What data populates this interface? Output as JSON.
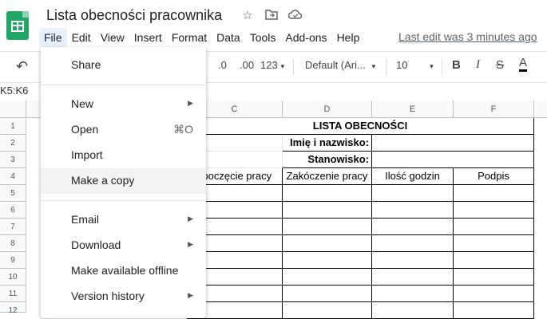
{
  "doc": {
    "title": "Lista obecności pracownika",
    "last_edit": "Last edit was 3 minutes ago"
  },
  "menubar": [
    "File",
    "Edit",
    "View",
    "Insert",
    "Format",
    "Data",
    "Tools",
    "Add-ons",
    "Help"
  ],
  "toolbar": {
    "decimal_decrease": ".0",
    "decimal_increase": ".00",
    "number_format": "123",
    "font": "Default (Ari...",
    "font_size": "10",
    "bold": "B",
    "italic": "I",
    "strikethrough": "S",
    "text_color": "A"
  },
  "namebox": "K5:K6",
  "file_menu": {
    "share": "Share",
    "new": "New",
    "open": "Open",
    "open_shortcut": "⌘O",
    "import": "Import",
    "make_copy": "Make a copy",
    "email": "Email",
    "download": "Download",
    "offline": "Make available offline",
    "version_history": "Version history"
  },
  "grid": {
    "columns": [
      "C",
      "D",
      "E",
      "F"
    ],
    "rows": [
      "1",
      "2",
      "3",
      "4",
      "5",
      "6",
      "7",
      "8",
      "9",
      "10",
      "11",
      "12"
    ],
    "title": "LISTA OBECNOŚCI",
    "name_label": "Imię i nazwisko:",
    "position_label": "Stanowisko:",
    "headers": [
      "zpoczęcie pracy",
      "Zakóczenie pracy",
      "Ilość godzin",
      "Podpis"
    ]
  },
  "colors": {
    "sheets_green": "#23a566",
    "menu_active": "#e8f0fe"
  }
}
